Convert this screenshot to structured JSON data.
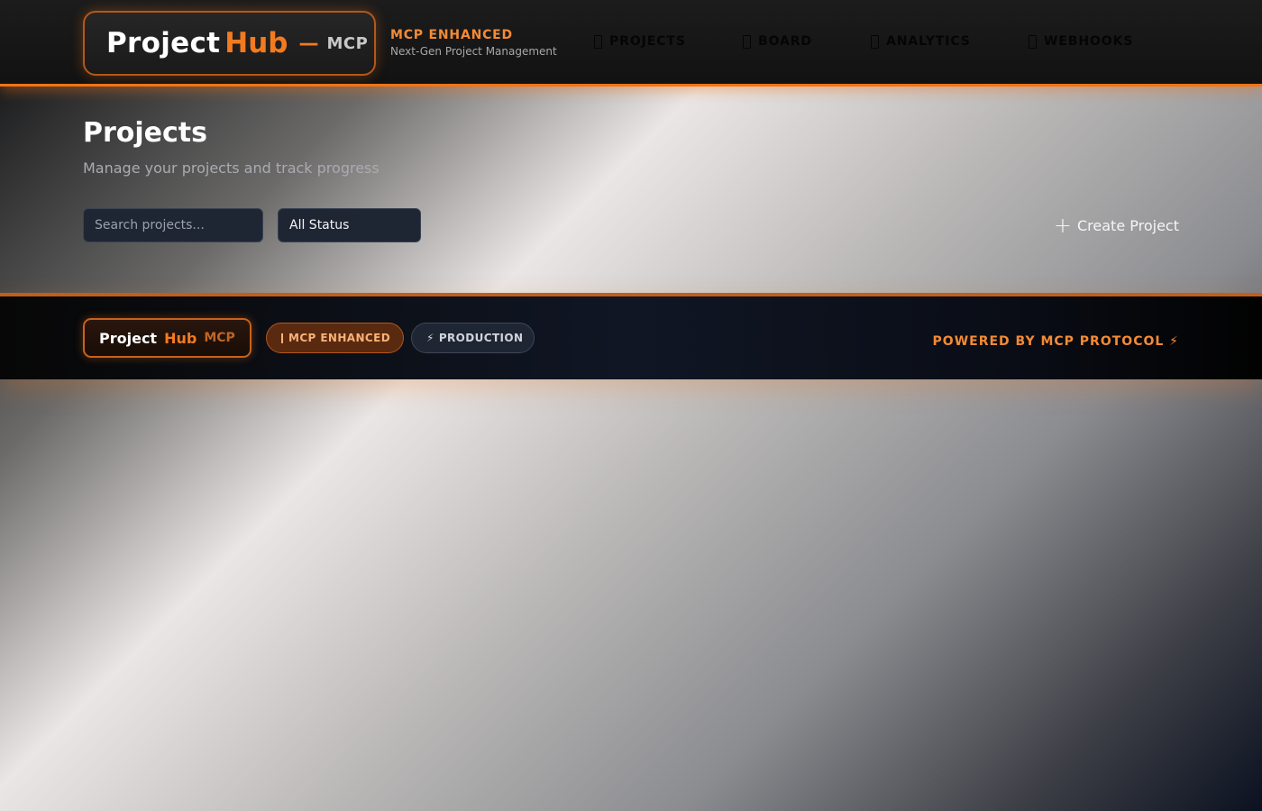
{
  "header": {
    "logo": {
      "project": "Project",
      "hub": "Hub",
      "dash": "—",
      "mcp": "MCP"
    },
    "brand": {
      "title": "MCP ENHANCED",
      "subtitle": "Next-Gen Project Management"
    },
    "nav": [
      {
        "label": "PROJECTS",
        "icon": "folder-icon"
      },
      {
        "label": "BOARD",
        "icon": "board-icon"
      },
      {
        "label": "ANALYTICS",
        "icon": "chart-icon"
      },
      {
        "label": "WEBHOOKS",
        "icon": "webhook-icon"
      }
    ]
  },
  "page": {
    "title": "Projects",
    "subtitle": "Manage your projects and track progress",
    "search": {
      "placeholder": "Search projects...",
      "value": ""
    },
    "status_filter": {
      "selected": "All Status"
    },
    "create_button": {
      "icon": "plus-icon",
      "label": "Create Project"
    }
  },
  "footer": {
    "logo": {
      "project": "Project",
      "hub": "Hub",
      "mcp": "MCP"
    },
    "badges": [
      {
        "label": "MCP ENHANCED",
        "icon": "box-icon"
      },
      {
        "label": "PRODUCTION",
        "glyph": "⚡",
        "icon": "lightning-icon"
      }
    ],
    "powered": "POWERED BY MCP PROTOCOL ⚡"
  },
  "colors": {
    "accent": "#f47a1f",
    "header_bg": "#141414",
    "input_bg": "#1e2533"
  }
}
